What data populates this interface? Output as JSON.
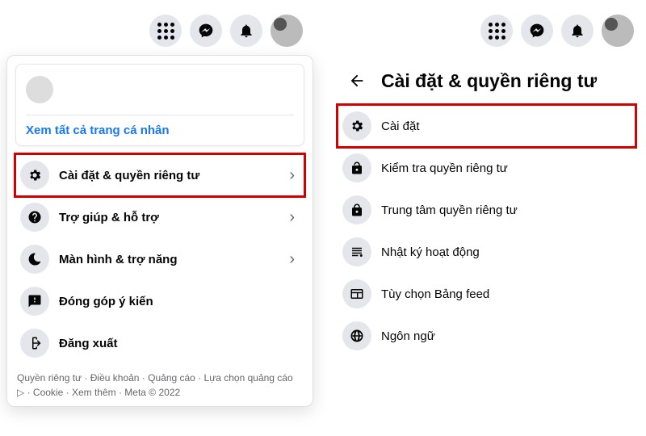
{
  "topbar": {
    "icons": [
      "apps-icon",
      "messenger-icon",
      "notifications-icon",
      "avatar-icon"
    ]
  },
  "left": {
    "profile_link": "Xem tất cả trang cá nhân",
    "menu": [
      {
        "icon": "gear-icon",
        "label": "Cài đặt & quyền riêng tư",
        "has_chevron": true,
        "highlight": true
      },
      {
        "icon": "question-icon",
        "label": "Trợ giúp & hỗ trợ",
        "has_chevron": true,
        "highlight": false
      },
      {
        "icon": "moon-icon",
        "label": "Màn hình & trợ năng",
        "has_chevron": true,
        "highlight": false
      },
      {
        "icon": "feedback-icon",
        "label": "Đóng góp ý kiến",
        "has_chevron": false,
        "highlight": false
      },
      {
        "icon": "logout-icon",
        "label": "Đăng xuất",
        "has_chevron": false,
        "highlight": false
      }
    ],
    "footer": {
      "links": [
        "Quyền riêng tư",
        "Điều khoản",
        "Quảng cáo",
        "Lựa chọn quảng cáo",
        "Cookie",
        "Xem thêm"
      ],
      "meta": "Meta © 2022"
    }
  },
  "right": {
    "title": "Cài đặt & quyền riêng tư",
    "menu": [
      {
        "icon": "gear-icon",
        "label": "Cài đặt",
        "highlight": true
      },
      {
        "icon": "unlock-icon",
        "label": "Kiểm tra quyền riêng tư",
        "highlight": false
      },
      {
        "icon": "lock-icon",
        "label": "Trung tâm quyền riêng tư",
        "highlight": false
      },
      {
        "icon": "activity-icon",
        "label": "Nhật ký hoạt động",
        "highlight": false
      },
      {
        "icon": "feed-icon",
        "label": "Tùy chọn Bảng feed",
        "highlight": false
      },
      {
        "icon": "globe-icon",
        "label": "Ngôn ngữ",
        "highlight": false
      }
    ]
  }
}
